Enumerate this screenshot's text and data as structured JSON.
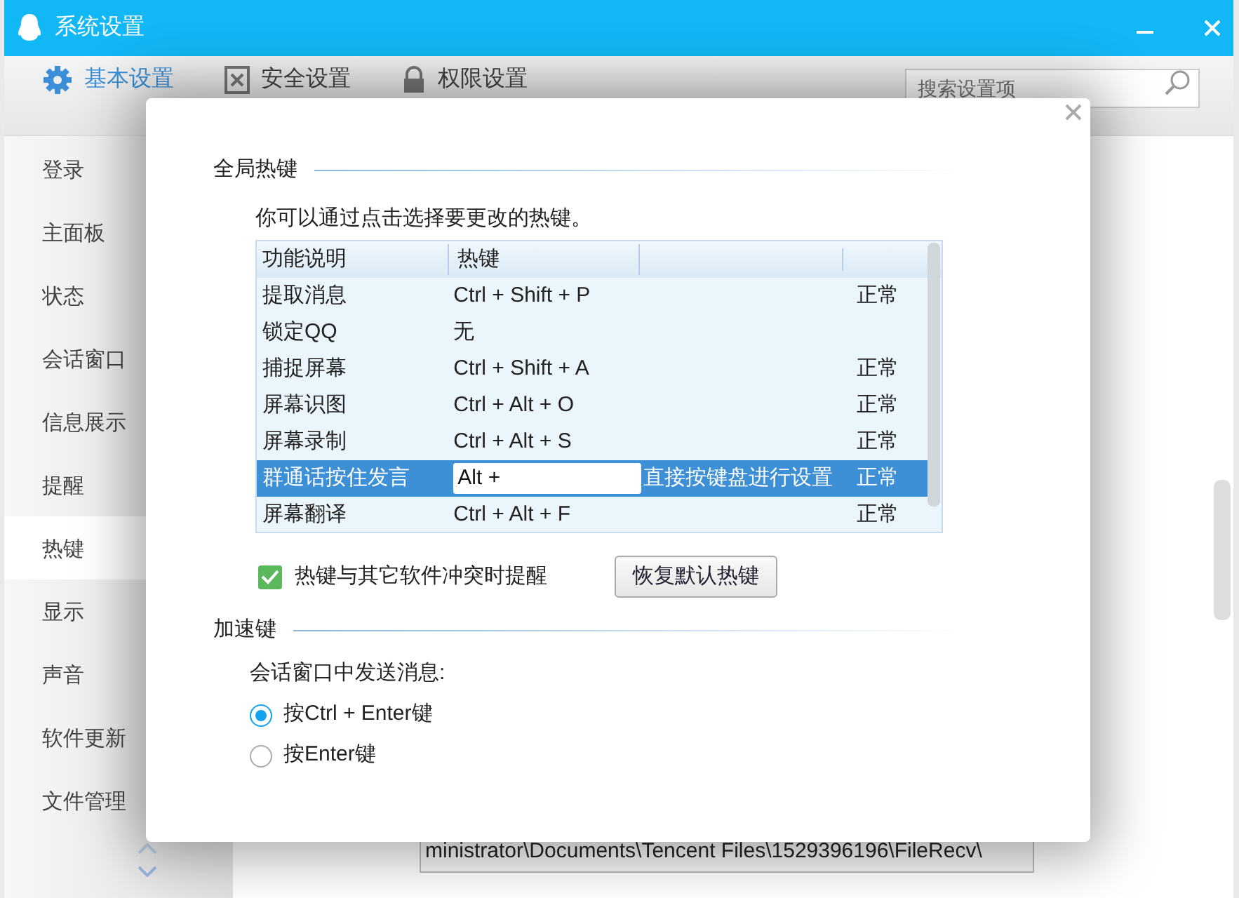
{
  "window": {
    "title": "系统设置"
  },
  "tabs": [
    {
      "label": "基本设置",
      "selected": true,
      "kind": "gear"
    },
    {
      "label": "安全设置",
      "selected": false,
      "kind": "shield"
    },
    {
      "label": "权限设置",
      "selected": false,
      "kind": "lock"
    }
  ],
  "search": {
    "placeholder": "搜索设置项"
  },
  "sidebar": {
    "items": [
      {
        "label": "登录",
        "selected": false
      },
      {
        "label": "主面板",
        "selected": false
      },
      {
        "label": "状态",
        "selected": false
      },
      {
        "label": "会话窗口",
        "selected": false
      },
      {
        "label": "信息展示",
        "selected": false
      },
      {
        "label": "提醒",
        "selected": false
      },
      {
        "label": "热键",
        "selected": true
      },
      {
        "label": "显示",
        "selected": false
      },
      {
        "label": "声音",
        "selected": false
      },
      {
        "label": "软件更新",
        "selected": false
      },
      {
        "label": "文件管理",
        "selected": false
      }
    ]
  },
  "background": {
    "path_field": "ministrator\\Documents\\Tencent Files\\1529396196\\FileRecv\\"
  },
  "dialog": {
    "global_hotkeys": {
      "title": "全局热键",
      "description": "你可以通过点击选择要更改的热键。",
      "table": {
        "columns": [
          "功能说明",
          "热键"
        ],
        "rows": [
          {
            "kind": "text",
            "function": "提取消息",
            "hotkey": "Ctrl + Shift + P",
            "status": "正常",
            "selected": false
          },
          {
            "kind": "text",
            "function": "锁定QQ",
            "hotkey": "无",
            "selected": false
          },
          {
            "kind": "text",
            "function": "捕捉屏幕",
            "hotkey": "Ctrl + Shift + A",
            "status": "正常",
            "selected": false
          },
          {
            "kind": "text",
            "function": "屏幕识图",
            "hotkey": "Ctrl + Alt + O",
            "status": "正常",
            "selected": false
          },
          {
            "kind": "text",
            "function": "屏幕录制",
            "hotkey": "Ctrl + Alt + S",
            "status": "正常",
            "selected": false
          },
          {
            "kind": "edit",
            "function": "群通话按住发言",
            "hotkey": "Alt +",
            "hint": "直接按键盘进行设置",
            "status": "正常",
            "selected": true
          },
          {
            "kind": "text",
            "function": "屏幕翻译",
            "hotkey": "Ctrl + Alt + F",
            "status": "正常",
            "selected": false
          }
        ]
      },
      "conflict_checkbox": {
        "label": "热键与其它软件冲突时提醒",
        "checked": true
      },
      "restore_button": "恢复默认热键"
    },
    "accelerator": {
      "title": "加速键",
      "prompt": "会话窗口中发送消息:",
      "options": [
        {
          "label": "按Ctrl + Enter键",
          "selected": true
        },
        {
          "label": "按Enter键",
          "selected": false
        }
      ]
    }
  }
}
